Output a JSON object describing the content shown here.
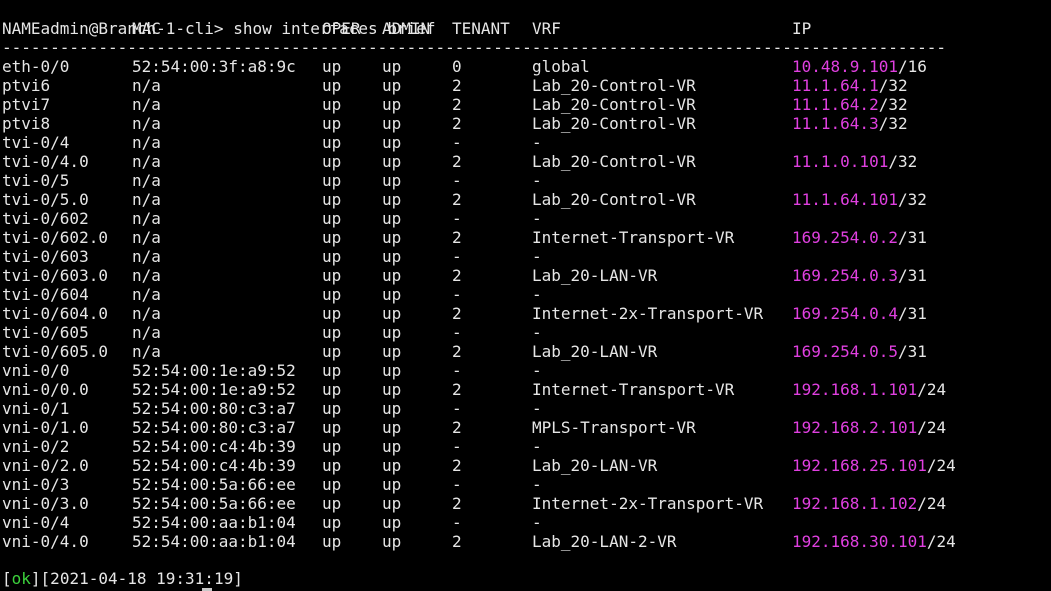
{
  "prompt": "admin@Branch-1-cli> show interfaces brief",
  "headers": {
    "name": "NAME",
    "mac": "MAC",
    "oper": "OPER",
    "admin": "ADMIN",
    "tenant": "TENANT",
    "vrf": "VRF",
    "ip": "IP"
  },
  "separator": "--------------------------------------------------------------------------------------------------",
  "rows": [
    {
      "name": "eth-0/0",
      "mac": "52:54:00:3f:a8:9c",
      "oper": "up",
      "admin": "up",
      "tenant": "0",
      "vrf": "global",
      "ip": "10.48.9.101",
      "mask": "/16"
    },
    {
      "name": "ptvi6",
      "mac": "n/a",
      "oper": "up",
      "admin": "up",
      "tenant": "2",
      "vrf": "Lab_20-Control-VR",
      "ip": "11.1.64.1",
      "mask": "/32"
    },
    {
      "name": "ptvi7",
      "mac": "n/a",
      "oper": "up",
      "admin": "up",
      "tenant": "2",
      "vrf": "Lab_20-Control-VR",
      "ip": "11.1.64.2",
      "mask": "/32"
    },
    {
      "name": "ptvi8",
      "mac": "n/a",
      "oper": "up",
      "admin": "up",
      "tenant": "2",
      "vrf": "Lab_20-Control-VR",
      "ip": "11.1.64.3",
      "mask": "/32"
    },
    {
      "name": "tvi-0/4",
      "mac": "n/a",
      "oper": "up",
      "admin": "up",
      "tenant": "-",
      "vrf": "-",
      "ip": "",
      "mask": ""
    },
    {
      "name": "tvi-0/4.0",
      "mac": "n/a",
      "oper": "up",
      "admin": "up",
      "tenant": "2",
      "vrf": "Lab_20-Control-VR",
      "ip": "11.1.0.101",
      "mask": "/32"
    },
    {
      "name": "tvi-0/5",
      "mac": "n/a",
      "oper": "up",
      "admin": "up",
      "tenant": "-",
      "vrf": "-",
      "ip": "",
      "mask": ""
    },
    {
      "name": "tvi-0/5.0",
      "mac": "n/a",
      "oper": "up",
      "admin": "up",
      "tenant": "2",
      "vrf": "Lab_20-Control-VR",
      "ip": "11.1.64.101",
      "mask": "/32"
    },
    {
      "name": "tvi-0/602",
      "mac": "n/a",
      "oper": "up",
      "admin": "up",
      "tenant": "-",
      "vrf": "-",
      "ip": "",
      "mask": ""
    },
    {
      "name": "tvi-0/602.0",
      "mac": "n/a",
      "oper": "up",
      "admin": "up",
      "tenant": "2",
      "vrf": "Internet-Transport-VR",
      "ip": "169.254.0.2",
      "mask": "/31"
    },
    {
      "name": "tvi-0/603",
      "mac": "n/a",
      "oper": "up",
      "admin": "up",
      "tenant": "-",
      "vrf": "-",
      "ip": "",
      "mask": ""
    },
    {
      "name": "tvi-0/603.0",
      "mac": "n/a",
      "oper": "up",
      "admin": "up",
      "tenant": "2",
      "vrf": "Lab_20-LAN-VR",
      "ip": "169.254.0.3",
      "mask": "/31"
    },
    {
      "name": "tvi-0/604",
      "mac": "n/a",
      "oper": "up",
      "admin": "up",
      "tenant": "-",
      "vrf": "-",
      "ip": "",
      "mask": ""
    },
    {
      "name": "tvi-0/604.0",
      "mac": "n/a",
      "oper": "up",
      "admin": "up",
      "tenant": "2",
      "vrf": "Internet-2x-Transport-VR",
      "ip": "169.254.0.4",
      "mask": "/31"
    },
    {
      "name": "tvi-0/605",
      "mac": "n/a",
      "oper": "up",
      "admin": "up",
      "tenant": "-",
      "vrf": "-",
      "ip": "",
      "mask": ""
    },
    {
      "name": "tvi-0/605.0",
      "mac": "n/a",
      "oper": "up",
      "admin": "up",
      "tenant": "2",
      "vrf": "Lab_20-LAN-VR",
      "ip": "169.254.0.5",
      "mask": "/31"
    },
    {
      "name": "vni-0/0",
      "mac": "52:54:00:1e:a9:52",
      "oper": "up",
      "admin": "up",
      "tenant": "-",
      "vrf": "-",
      "ip": "",
      "mask": ""
    },
    {
      "name": "vni-0/0.0",
      "mac": "52:54:00:1e:a9:52",
      "oper": "up",
      "admin": "up",
      "tenant": "2",
      "vrf": "Internet-Transport-VR",
      "ip": "192.168.1.101",
      "mask": "/24"
    },
    {
      "name": "vni-0/1",
      "mac": "52:54:00:80:c3:a7",
      "oper": "up",
      "admin": "up",
      "tenant": "-",
      "vrf": "-",
      "ip": "",
      "mask": ""
    },
    {
      "name": "vni-0/1.0",
      "mac": "52:54:00:80:c3:a7",
      "oper": "up",
      "admin": "up",
      "tenant": "2",
      "vrf": "MPLS-Transport-VR",
      "ip": "192.168.2.101",
      "mask": "/24"
    },
    {
      "name": "vni-0/2",
      "mac": "52:54:00:c4:4b:39",
      "oper": "up",
      "admin": "up",
      "tenant": "-",
      "vrf": "-",
      "ip": "",
      "mask": ""
    },
    {
      "name": "vni-0/2.0",
      "mac": "52:54:00:c4:4b:39",
      "oper": "up",
      "admin": "up",
      "tenant": "2",
      "vrf": "Lab_20-LAN-VR",
      "ip": "192.168.25.101",
      "mask": "/24"
    },
    {
      "name": "vni-0/3",
      "mac": "52:54:00:5a:66:ee",
      "oper": "up",
      "admin": "up",
      "tenant": "-",
      "vrf": "-",
      "ip": "",
      "mask": ""
    },
    {
      "name": "vni-0/3.0",
      "mac": "52:54:00:5a:66:ee",
      "oper": "up",
      "admin": "up",
      "tenant": "2",
      "vrf": "Internet-2x-Transport-VR",
      "ip": "192.168.1.102",
      "mask": "/24"
    },
    {
      "name": "vni-0/4",
      "mac": "52:54:00:aa:b1:04",
      "oper": "up",
      "admin": "up",
      "tenant": "-",
      "vrf": "-",
      "ip": "",
      "mask": ""
    },
    {
      "name": "vni-0/4.0",
      "mac": "52:54:00:aa:b1:04",
      "oper": "up",
      "admin": "up",
      "tenant": "2",
      "vrf": "Lab_20-LAN-2-VR",
      "ip": "192.168.30.101",
      "mask": "/24"
    }
  ],
  "status": {
    "open": "[",
    "ok": "ok",
    "close": "]",
    "timestamp": "[2021-04-18 19:31:19]"
  },
  "colors": {
    "background": "#000000",
    "text": "#e6e6e6",
    "ip": "#e040e0",
    "ok": "#3cd23c"
  }
}
